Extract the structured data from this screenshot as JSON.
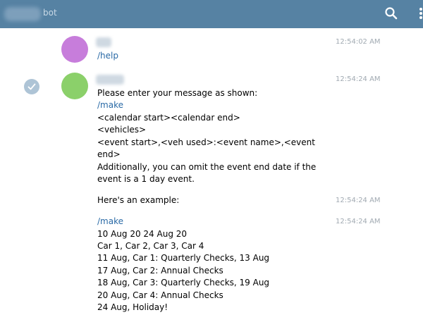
{
  "header": {
    "title": "bot",
    "search_icon": "search-icon",
    "menu_icon": "more-vertical-icon"
  },
  "colors": {
    "header_bg": "#5682a3",
    "link": "#2a6aa6",
    "timestamp": "#a1aab2",
    "avatar_user": "#c77ddb",
    "avatar_bot": "#8bd06a"
  },
  "messages": [
    {
      "time": "12:54:02 AM",
      "lines": [
        "/help"
      ]
    },
    {
      "time": "12:54:24 AM",
      "lines": [
        "Please enter your message as shown:",
        "/make",
        "<calendar start><calendar end>",
        "<vehicles>",
        "<event start>,<veh used>:<event name>,<event",
        "end>",
        "Additionally, you can omit the event end date if the",
        "event is a 1 day event."
      ]
    },
    {
      "time": "12:54:24 AM",
      "lines": [
        "Here's an example:"
      ]
    },
    {
      "time": "12:54:24 AM",
      "lines": [
        "/make",
        "10 Aug 20 24 Aug 20",
        "Car 1, Car 2, Car 3, Car 4",
        "11 Aug, Car 1: Quarterly Checks, 13 Aug",
        "17 Aug, Car 2: Annual Checks",
        "18 Aug, Car 3: Quarterly Checks, 19 Aug",
        "20 Aug, Car 4: Annual Checks",
        "24 Aug, Holiday!"
      ]
    }
  ]
}
